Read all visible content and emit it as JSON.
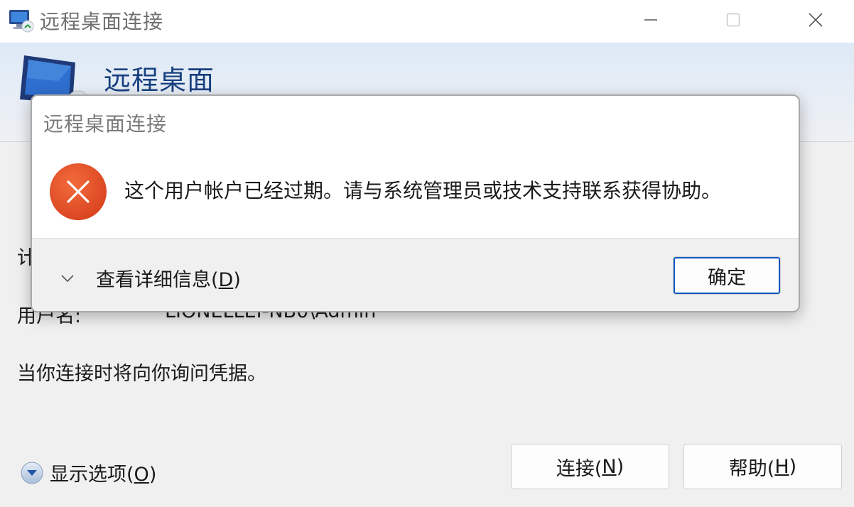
{
  "window": {
    "title": "远程桌面连接",
    "controls": {
      "minimize": "minimize-icon",
      "maximize": "maximize-icon",
      "close": "close-icon"
    }
  },
  "banner": {
    "title": "远程桌面",
    "icon": "remote-desktop-monitor-icon"
  },
  "main": {
    "computer_label": "计",
    "username_label": "用户名:",
    "username_value": "LIONELLEI-NB0\\Admin",
    "info_text": "当你连接时将向你询问凭据。",
    "options_label_pre": "显示选项(",
    "options_mnemonic": "O",
    "options_label_post": ")",
    "connect_pre": "连接(",
    "connect_mnemonic": "N",
    "connect_post": ")",
    "help_pre": "帮助(",
    "help_mnemonic": "H",
    "help_post": ")"
  },
  "dialog": {
    "title": "远程桌面连接",
    "message": "这个用户帐户已经过期。请与系统管理员或技术支持联系获得协助。",
    "details_pre": "查看详细信息(",
    "details_mnemonic": "D",
    "details_post": ")",
    "ok_label": "确定",
    "icon": "error-icon"
  },
  "colors": {
    "accent": "#0b57c2",
    "banner_title": "#17407f",
    "error": "#e8552a"
  }
}
